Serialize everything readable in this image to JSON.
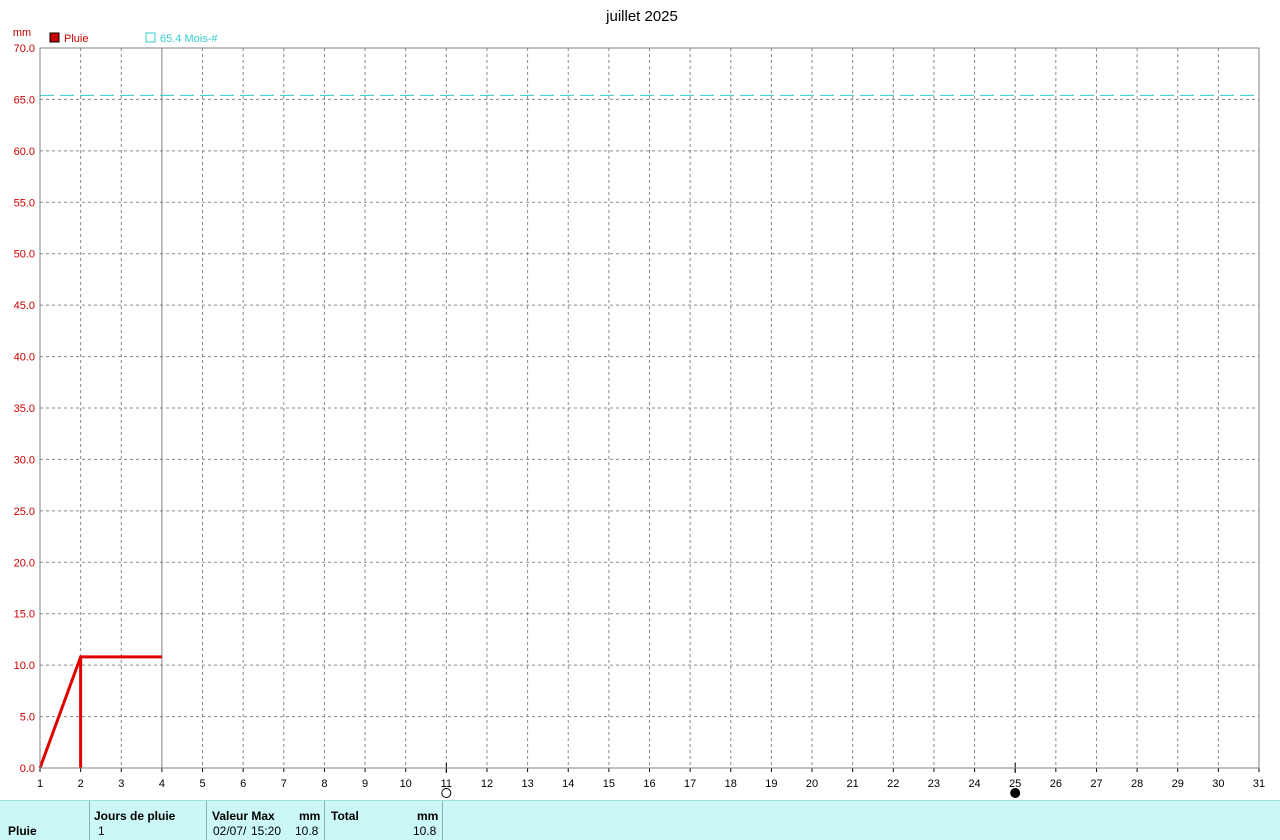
{
  "chart_data": {
    "type": "line",
    "title": "juillet 2025",
    "ylabel": "mm",
    "xlabel": "",
    "xlim": [
      1,
      31
    ],
    "ylim": [
      0,
      70
    ],
    "x_ticks": [
      1,
      2,
      3,
      4,
      5,
      6,
      7,
      8,
      9,
      10,
      11,
      12,
      13,
      14,
      15,
      16,
      17,
      18,
      19,
      20,
      21,
      22,
      23,
      24,
      25,
      26,
      27,
      28,
      29,
      30,
      31
    ],
    "y_ticks": [
      "0.0",
      "5.0",
      "10.0",
      "15.0",
      "20.0",
      "25.0",
      "30.0",
      "35.0",
      "40.0",
      "45.0",
      "50.0",
      "55.0",
      "60.0",
      "65.0",
      "70.0"
    ],
    "grid": true,
    "legend_position": "top-left",
    "series": [
      {
        "name": "Pluie",
        "color": "#e00000",
        "cumulative": [
          [
            1,
            0.0
          ],
          [
            2,
            10.8
          ],
          [
            4,
            10.8
          ]
        ],
        "bars": [
          [
            2,
            10.8
          ]
        ]
      }
    ],
    "reference_line": {
      "label": "65.4 Mois-#",
      "value": 65.4,
      "color": "#33cccc"
    },
    "current_day_marker": 4,
    "moon_phases": [
      {
        "day": 11,
        "phase": "full-moon"
      },
      {
        "day": 25,
        "phase": "new-moon"
      }
    ]
  },
  "stats": {
    "row_label": "Pluie",
    "rain_days": {
      "header": "Jours de pluie",
      "value": "1"
    },
    "max_value": {
      "header": "Valeur Max",
      "unit": "mm",
      "date": "02/07/",
      "time": "15:20",
      "value": "10.8"
    },
    "total": {
      "header": "Total",
      "unit": "mm",
      "value": "10.8"
    }
  }
}
